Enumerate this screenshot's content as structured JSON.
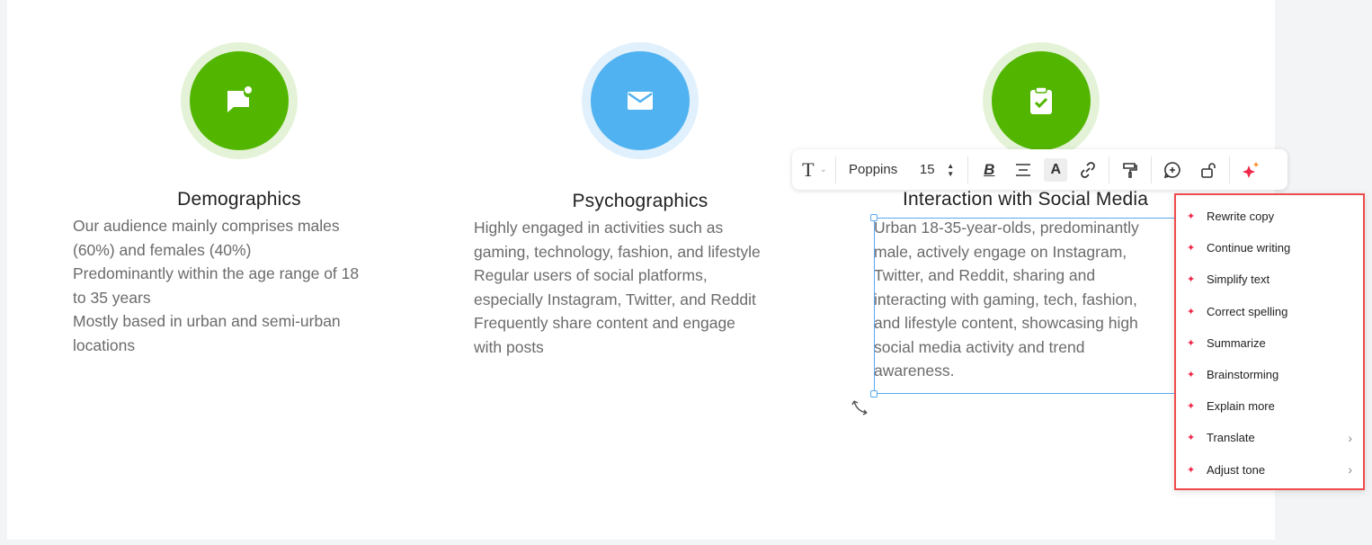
{
  "columns": [
    {
      "title": "Demographics",
      "icon": "chat-bubble-icon",
      "color": "#52b600",
      "ring": "#e4f3d7",
      "lines": [
        "Our audience mainly comprises males",
        "(60%) and females (40%)",
        "Predominantly within the age range of 18",
        "to 35 years",
        "Mostly based in urban and semi-urban",
        "locations"
      ]
    },
    {
      "title": "Psychographics",
      "icon": "envelope-icon",
      "color": "#50b2f0",
      "ring": "#e0f0fc",
      "lines": [
        "Highly engaged in activities such as",
        "gaming, technology, fashion, and lifestyle",
        "Regular users of social platforms,",
        "especially Instagram, Twitter, and Reddit",
        "Frequently share content and engage",
        "with posts"
      ]
    },
    {
      "title": "Interaction with Social Media",
      "icon": "clipboard-check-icon",
      "color": "#52b600",
      "ring": "#e4f3d7",
      "lines": [
        "Urban 18-35-year-olds, predominantly",
        "male, actively engage on Instagram,",
        "Twitter, and Reddit, sharing and",
        "interacting with gaming, tech, fashion,",
        "and lifestyle content, showcasing high",
        "social media activity and trend",
        "awareness."
      ]
    }
  ],
  "toolbar": {
    "font": "Poppins",
    "size": "15",
    "ai_color": "#f0284a"
  },
  "ai_menu": {
    "items": [
      {
        "label": "Rewrite copy",
        "submenu": false
      },
      {
        "label": "Continue writing",
        "submenu": false
      },
      {
        "label": "Simplify text",
        "submenu": false
      },
      {
        "label": "Correct spelling",
        "submenu": false
      },
      {
        "label": "Summarize",
        "submenu": false
      },
      {
        "label": "Brainstorming",
        "submenu": false
      },
      {
        "label": "Explain more",
        "submenu": false
      },
      {
        "label": "Translate",
        "submenu": true
      },
      {
        "label": "Adjust tone",
        "submenu": true
      }
    ]
  }
}
